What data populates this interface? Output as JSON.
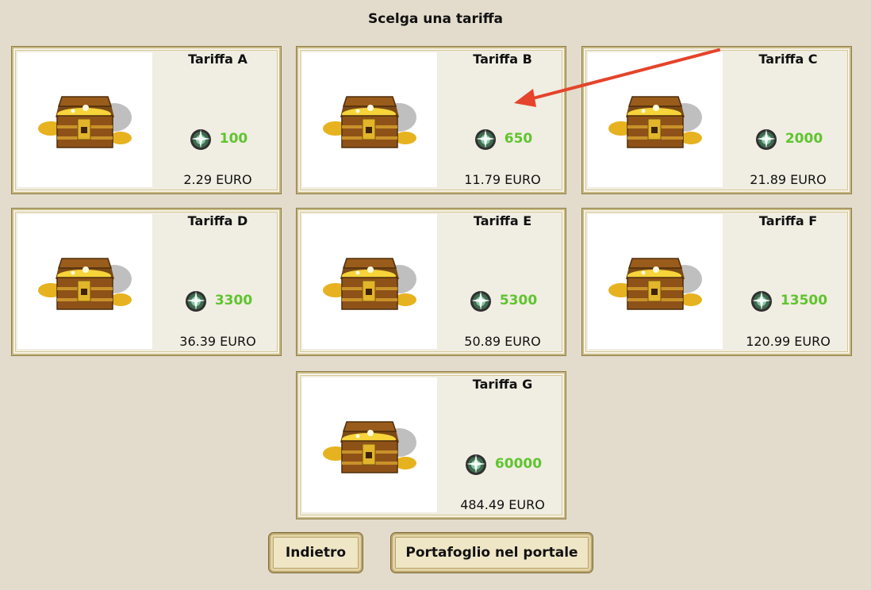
{
  "page": {
    "title": "Scelga una tariffa"
  },
  "tariffs": [
    {
      "name": "Tariffa A",
      "amount": "100",
      "price": "2.29 EURO"
    },
    {
      "name": "Tariffa B",
      "amount": "650",
      "price": "11.79 EURO"
    },
    {
      "name": "Tariffa C",
      "amount": "2000",
      "price": "21.89 EURO"
    },
    {
      "name": "Tariffa D",
      "amount": "3300",
      "price": "36.39 EURO"
    },
    {
      "name": "Tariffa E",
      "amount": "5300",
      "price": "50.89 EURO"
    },
    {
      "name": "Tariffa F",
      "amount": "13500",
      "price": "120.99 EURO"
    },
    {
      "name": "Tariffa G",
      "amount": "60000",
      "price": "484.49 EURO"
    }
  ],
  "buttons": {
    "back_label": "Indietro",
    "portal_wallet_label": "Portafoglio nel portale"
  },
  "colors": {
    "background": "#e3dccc",
    "amount_green": "#5fc42f",
    "annotation_arrow": "#e5432b"
  },
  "icons": {
    "chest": "treasure-chest-icon",
    "gem": "crystal-gem-icon"
  }
}
